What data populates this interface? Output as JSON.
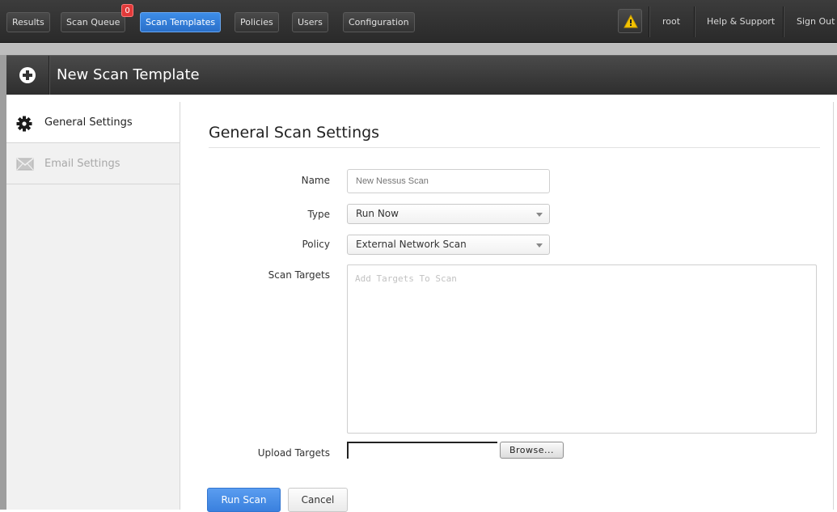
{
  "topnav": {
    "results": "Results",
    "scan_queue": "Scan Queue",
    "scan_queue_badge": "0",
    "scan_templates": "Scan Templates",
    "policies": "Policies",
    "users": "Users",
    "configuration": "Configuration",
    "user": "root",
    "help": "Help & Support",
    "signout": "Sign Out",
    "warning_icon": "warning-triangle-icon"
  },
  "header": {
    "title": "New Scan Template",
    "icon": "plus-circle-icon"
  },
  "sidebar": {
    "items": [
      {
        "label": "General Settings",
        "icon": "gear-icon",
        "active": true
      },
      {
        "label": "Email Settings",
        "icon": "envelope-icon",
        "active": false
      }
    ]
  },
  "form": {
    "title": "General Scan Settings",
    "name_label": "Name",
    "name_placeholder": "New Nessus Scan",
    "type_label": "Type",
    "type_value": "Run Now",
    "policy_label": "Policy",
    "policy_value": "External Network Scan",
    "targets_label": "Scan Targets",
    "targets_placeholder": "Add Targets To Scan",
    "upload_label": "Upload Targets",
    "browse_label": "Browse..."
  },
  "actions": {
    "run": "Run Scan",
    "cancel": "Cancel"
  },
  "colors": {
    "accent": "#3a80de",
    "badge": "#e23a3a",
    "warning": "#f5c400"
  }
}
